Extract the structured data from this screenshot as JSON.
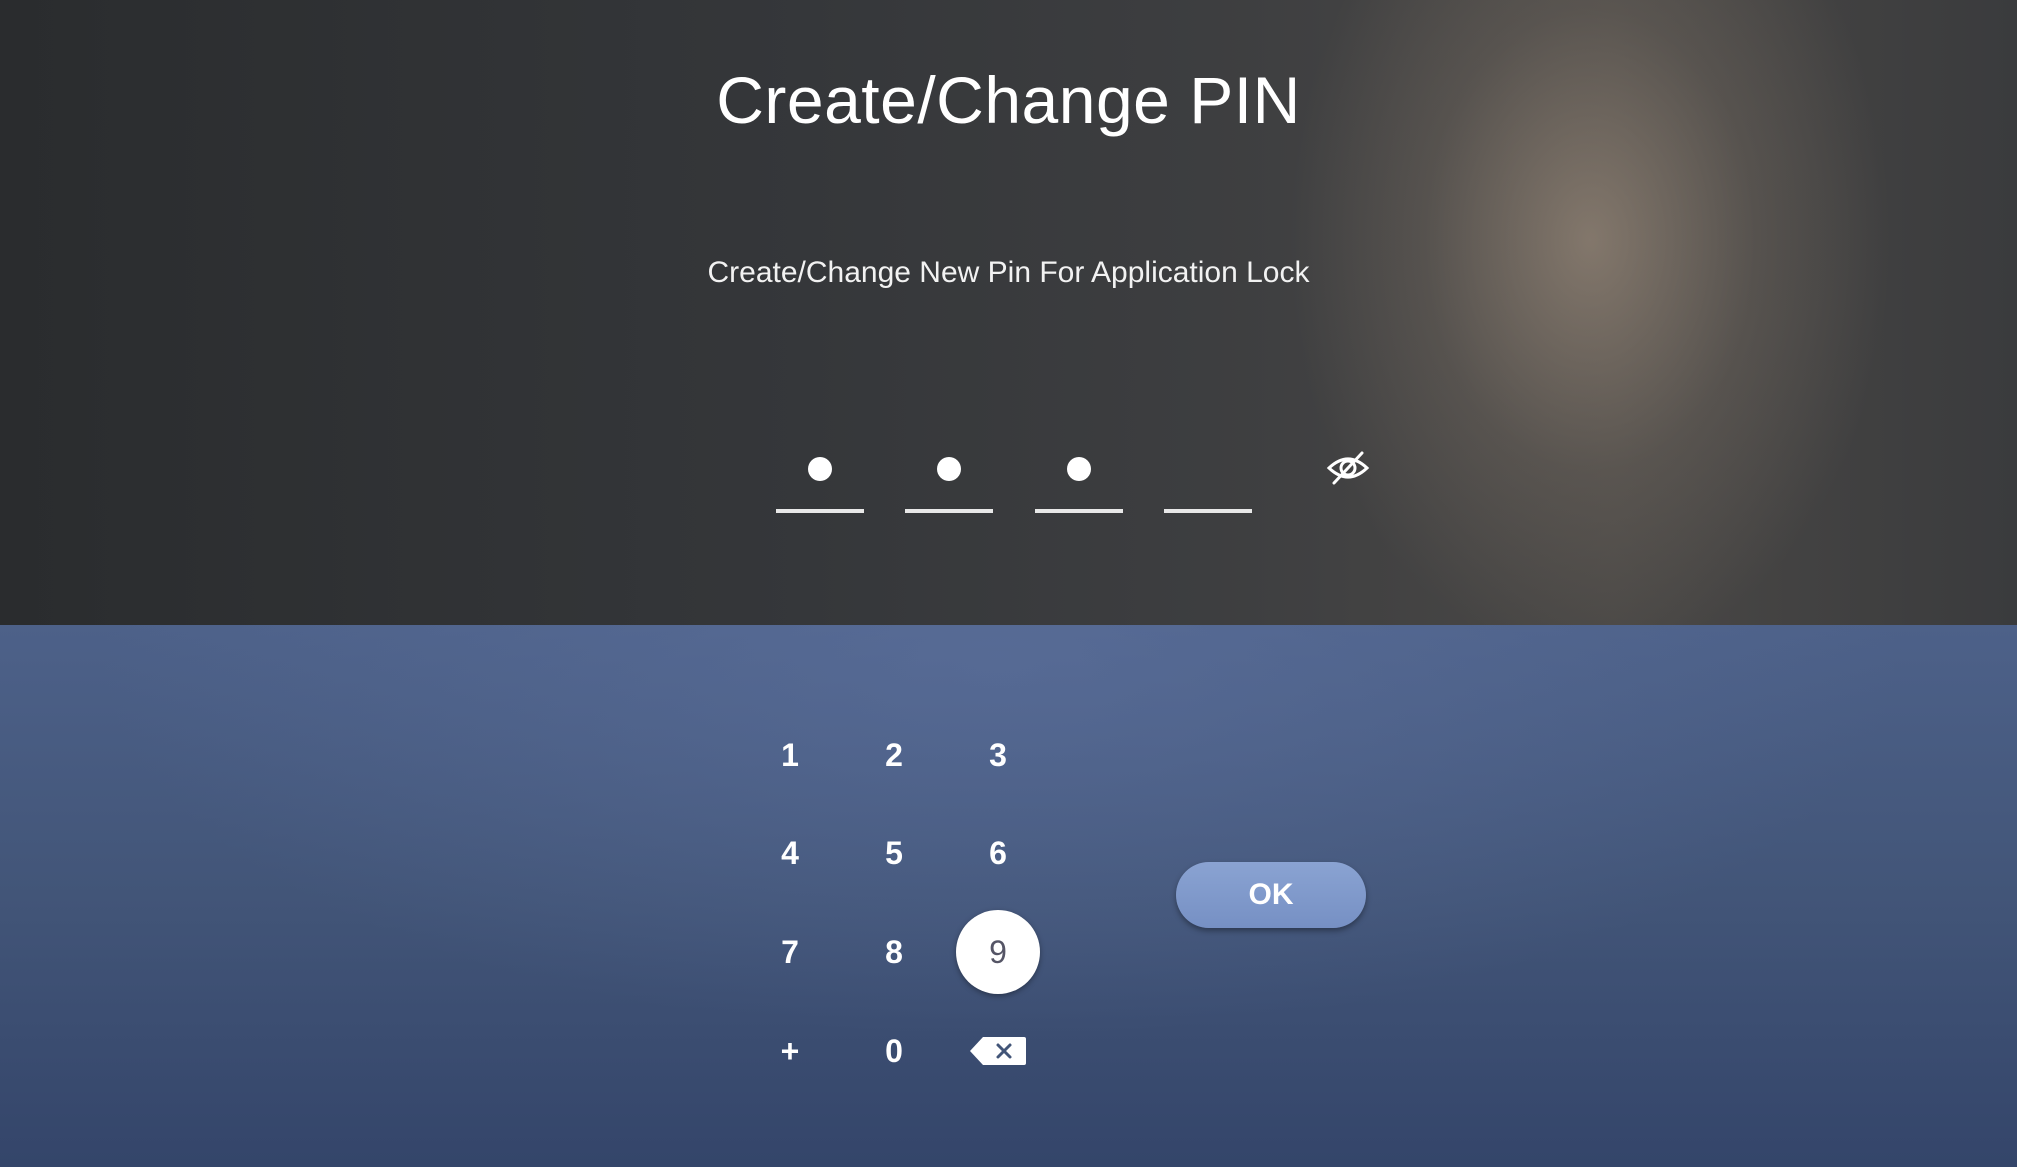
{
  "header": {
    "title": "Create/Change PIN",
    "subtitle": "Create/Change New Pin For Application Lock"
  },
  "pin": {
    "length": 4,
    "filled": 3,
    "visibility_icon": "eye-off-icon"
  },
  "keypad": {
    "keys": [
      "1",
      "2",
      "3",
      "4",
      "5",
      "6",
      "7",
      "8",
      "9",
      "+",
      "0"
    ],
    "focused_key": "9",
    "backspace_icon": "backspace-icon"
  },
  "actions": {
    "ok_label": "OK"
  },
  "colors": {
    "top_background": "#35373a",
    "bottom_background": "#425578",
    "ok_button": "#7f99cb",
    "focus_ring": "#ffffff"
  }
}
